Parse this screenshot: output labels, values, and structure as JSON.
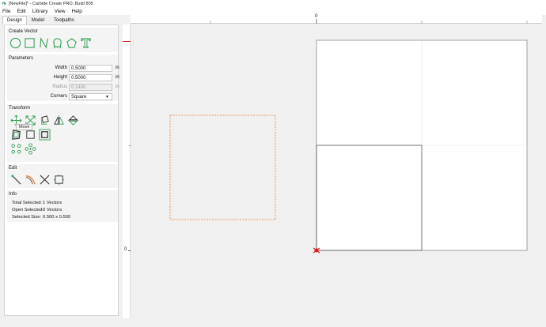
{
  "window": {
    "title": "[NewFile]* - Carbide Create PRO, Build 805"
  },
  "menu": [
    "File",
    "Edit",
    "Library",
    "View",
    "Help"
  ],
  "tabs": [
    "Design",
    "Model",
    "Toolpaths"
  ],
  "sections": {
    "create_vector": "Create Vector",
    "parameters": "Parameters",
    "transform": "Transform",
    "edit": "Edit",
    "info": "Info"
  },
  "create_vector_icons": [
    "circle-icon",
    "rectangle-icon",
    "polyline-icon",
    "polygon-icon",
    "pentagon-icon",
    "text-icon"
  ],
  "parameters": {
    "width": {
      "label": "Width",
      "value": "0.5000",
      "unit": "in"
    },
    "height": {
      "label": "Height",
      "value": "0.5000",
      "unit": "in"
    },
    "radius": {
      "label": "Radius",
      "value": "0.1400",
      "unit": "in"
    },
    "corners": {
      "label": "Corners",
      "value": "Square"
    }
  },
  "transform_icons": [
    "move-icon",
    "scale-icon",
    "rotate-icon",
    "mirror-icon",
    "flip-icon",
    "offset-icon",
    "boolean-icon",
    "node-edit-icon",
    "array-icon",
    "circular-array-icon"
  ],
  "tooltip": "Move",
  "edit_icons": [
    "trim-icon",
    "knife-icon",
    "cut-icon",
    "join-icon"
  ],
  "info": {
    "total_selected": {
      "label": "Total Selected:",
      "value": "1 Vectors"
    },
    "open_selected": {
      "label": "Open Selected:",
      "value": "0 Vectors"
    },
    "selected_size": {
      "label": "Selected Size:",
      "value": "0.500 x 0.500"
    }
  },
  "rulers": {
    "h_zero": "0",
    "v_zero": "0"
  },
  "colors": {
    "accent_green": "#3aa35a",
    "selection_orange": "#e8803a",
    "origin_red": "#e02020"
  }
}
